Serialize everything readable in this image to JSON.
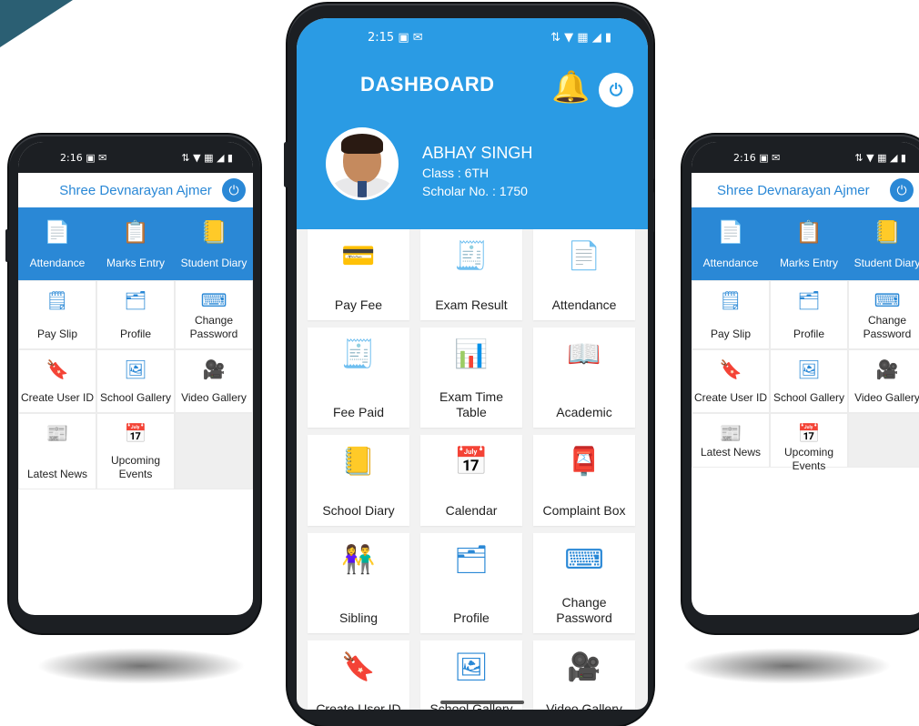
{
  "colors": {
    "primary": "#2a9be4",
    "accent": "#2a88d6",
    "corner": "#2b5f73"
  },
  "left_phone": {
    "status": {
      "time": "2:16",
      "left_icons": "▣ ✉",
      "right_icons": "⇅ ▼ ▦ ◢ ▮"
    },
    "header": {
      "title": "Shree Devnarayan Ajmer",
      "power_icon": "⏻"
    },
    "tabs": [
      {
        "label": "Attendance",
        "icon": "📄"
      },
      {
        "label": "Marks Entry",
        "icon": "📋"
      },
      {
        "label": "Student Diary",
        "icon": "📒"
      }
    ],
    "grid": [
      {
        "label": "Pay Slip",
        "icon": "🗒"
      },
      {
        "label": "Profile",
        "icon": "🗂"
      },
      {
        "label": "Change Password",
        "icon": "⌨"
      },
      {
        "label": "Create User ID",
        "icon": "🔖"
      },
      {
        "label": "School Gallery",
        "icon": "🖼"
      },
      {
        "label": "Video Gallery",
        "icon": "🎥"
      },
      {
        "label": "Latest News",
        "icon": "📰"
      },
      {
        "label": "Upcoming Events",
        "icon": "📅"
      }
    ]
  },
  "main_phone": {
    "status": {
      "time": "2:15",
      "left_icons": "▣ ✉",
      "right_icons": "⇅ ▼ ▦ ◢ ▮"
    },
    "title": "DASHBOARD",
    "bell_icon": "🔔",
    "power_icon": "⏻",
    "student": {
      "name": "ABHAY SINGH",
      "class": "Class : 6TH",
      "scholar": "Scholar No. : 1750"
    },
    "tiles": [
      {
        "label": "Pay Fee",
        "icon": "💳"
      },
      {
        "label": "Exam Result",
        "icon": "🧾"
      },
      {
        "label": "Attendance",
        "icon": "📄"
      },
      {
        "label": "Fee Paid",
        "icon": "🧾"
      },
      {
        "label": "Exam Time Table",
        "icon": "📊"
      },
      {
        "label": "Academic",
        "icon": "📖"
      },
      {
        "label": "School Diary",
        "icon": "📒"
      },
      {
        "label": "Calendar",
        "icon": "📅"
      },
      {
        "label": "Complaint Box",
        "icon": "📮"
      },
      {
        "label": "Sibling",
        "icon": "👫"
      },
      {
        "label": "Profile",
        "icon": "🗂"
      },
      {
        "label": "Change Password",
        "icon": "⌨"
      },
      {
        "label": "Create User ID",
        "icon": "🔖"
      },
      {
        "label": "School Gallery",
        "icon": "🖼"
      },
      {
        "label": "Video Gallery",
        "icon": "🎥"
      }
    ]
  },
  "right_phone": {
    "status": {
      "time": "2:16",
      "left_icons": "▣ ✉",
      "right_icons": "⇅ ▼ ▦ ◢ ▮"
    },
    "header": {
      "title": "Shree Devnarayan Ajmer",
      "power_icon": "⏻"
    },
    "tabs": [
      {
        "label": "Attendance",
        "icon": "📄"
      },
      {
        "label": "Marks Entry",
        "icon": "📋"
      },
      {
        "label": "Student Diary",
        "icon": "📒"
      }
    ],
    "grid": [
      {
        "label": "Pay Slip",
        "icon": "🗒"
      },
      {
        "label": "Profile",
        "icon": "🗂"
      },
      {
        "label": "Change Password",
        "icon": "⌨"
      },
      {
        "label": "Create User ID",
        "icon": "🔖"
      },
      {
        "label": "School Gallery",
        "icon": "🖼"
      },
      {
        "label": "Video Gallery",
        "icon": "🎥"
      },
      {
        "label": "Latest News",
        "icon": "📰"
      },
      {
        "label": "Upcoming Events",
        "icon": "📅"
      }
    ]
  }
}
